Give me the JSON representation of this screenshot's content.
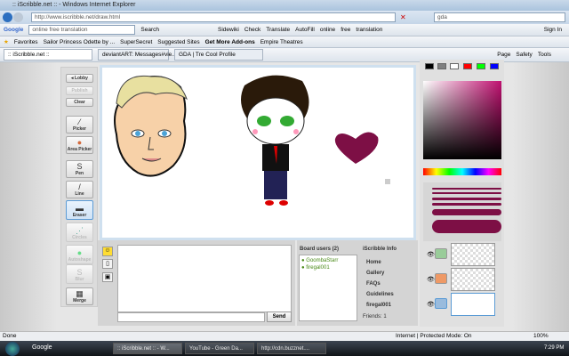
{
  "window": {
    "title": ":: iScribble.net :: - Windows Internet Explorer"
  },
  "address": {
    "url": "http://www.iscribble.net/draw.html",
    "search": "gda"
  },
  "google_toolbar": {
    "brand": "Google",
    "query": "online free translation",
    "items": [
      "Search",
      "Sidewiki",
      "Check",
      "Translate",
      "AutoFill",
      "online",
      "free",
      "translation"
    ],
    "sign_in": "Sign In"
  },
  "favorites": {
    "label": "Favorites",
    "items": [
      "Sailor Princess Odette by ...",
      "SuperSecret",
      "Suggested Sites",
      "Get More Add-ons",
      "Empire Theatres"
    ]
  },
  "tabs": [
    {
      "label": ":: iScribble.net ::"
    },
    {
      "label": "deviantART: Messages#vie..."
    },
    {
      "label": "GDA | Tre Cool Profile"
    }
  ],
  "command_bar": [
    "Page",
    "Safety",
    "Tools"
  ],
  "tools": {
    "lobby": "◂ Lobby",
    "publish": "Publish",
    "clear": "Clear",
    "picker": "Picker",
    "area_picker": "Area Picker",
    "pen": "Pen",
    "line": "Line",
    "eraser": "Eraser",
    "circles": "Circles",
    "autoshape": "Autoshape",
    "blur": "Blur",
    "merge": "Merge"
  },
  "chat": {
    "send": "Send",
    "input": ""
  },
  "users": {
    "header": "Board users (2)",
    "list": [
      "GoombaStarr",
      "firegal001"
    ]
  },
  "info": {
    "header": "iScribble Info",
    "links": [
      "Home",
      "Gallery",
      "FAQs",
      "Guidelines",
      "firegal001"
    ],
    "friends": "Friends: 1"
  },
  "palette": {
    "swatches": [
      "#000000",
      "#808080",
      "#ffffff",
      "#ff0000",
      "#00ff00",
      "#0000ff"
    ],
    "current": "#7d0f45"
  },
  "status": {
    "left": "Done",
    "zone": "Internet | Protected Mode: On",
    "zoom": "100%"
  },
  "taskbar": {
    "google": "Google",
    "tasks": [
      ":: iScribble.net :: - W...",
      "YouTube - Green Da...",
      "http://cdn.buzznet...."
    ],
    "clock": "7:29 PM"
  }
}
